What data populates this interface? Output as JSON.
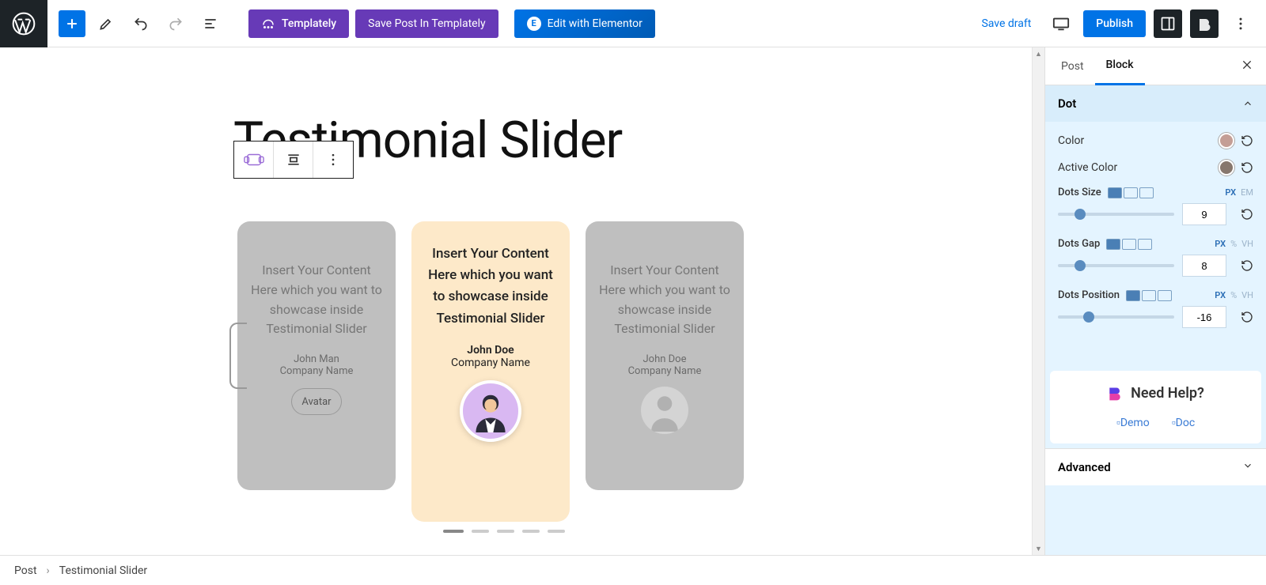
{
  "topbar": {
    "templately_label": "Templately",
    "save_in_templately_label": "Save Post In Templately",
    "elementor_label": "Edit with Elementor",
    "save_draft_label": "Save draft",
    "publish_label": "Publish"
  },
  "page": {
    "title": "Testimonial Slider"
  },
  "cards": [
    {
      "quote": "Insert Your Content Here which you want to showcase inside Testimonial Slider",
      "name": "John Man",
      "company": "Company Name",
      "avatar_chip": "Avatar"
    },
    {
      "quote": "Insert Your Content Here which you want to showcase inside Testimonial Slider",
      "name": "John Doe",
      "company": "Company Name"
    },
    {
      "quote": "Insert Your Content Here which you want to showcase inside Testimonial Slider",
      "name": "John Doe",
      "company": "Company Name"
    }
  ],
  "sidebar": {
    "tab_post": "Post",
    "tab_block": "Block",
    "panel_dot": "Dot",
    "color_label": "Color",
    "color_value": "#c49e95",
    "active_color_label": "Active Color",
    "active_color_value": "#87776d",
    "dots_size_label": "Dots Size",
    "dots_size_value": "9",
    "dots_size_units": [
      "PX",
      "EM"
    ],
    "dots_gap_label": "Dots Gap",
    "dots_gap_value": "8",
    "dots_gap_units": [
      "PX",
      "%",
      "VH"
    ],
    "dots_position_label": "Dots Position",
    "dots_position_value": "-16",
    "dots_position_units": [
      "PX",
      "%",
      "VH"
    ],
    "help_title": "Need Help?",
    "help_demo": "Demo",
    "help_doc": "Doc",
    "advanced_label": "Advanced"
  },
  "footer": {
    "crumb1": "Post",
    "crumb2": "Testimonial Slider"
  }
}
